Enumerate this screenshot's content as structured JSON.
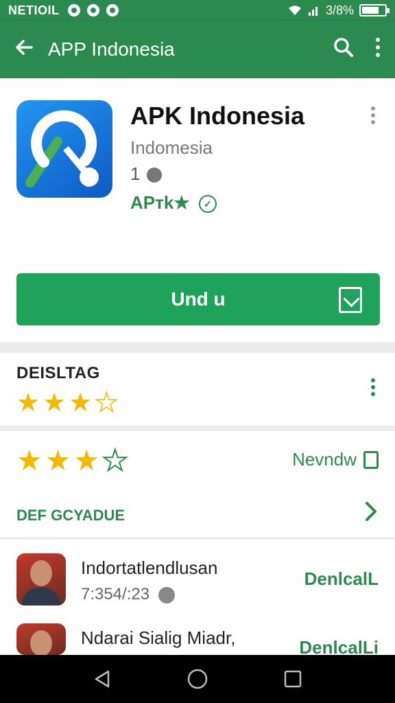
{
  "status_bar": {
    "carrier": "NETIOIL",
    "battery": "3/8%"
  },
  "app_bar": {
    "title": "APP Indonesia"
  },
  "app": {
    "name": "APK Indonesia",
    "developer": "Indomesia",
    "meta": "1",
    "tag": "APтk★",
    "install_label": "Und u",
    "icon_colors": [
      "#2196f3",
      "#0d5bc4"
    ]
  },
  "rating": {
    "title": "DEISLTAG",
    "stars": [
      "full",
      "full",
      "full",
      "empty"
    ]
  },
  "review": {
    "stars": [
      "full",
      "full",
      "full",
      "outline"
    ],
    "write_label": "Nevndw",
    "more_label": "DEF GCYADUE"
  },
  "list": [
    {
      "title": "Indortatlendlusan",
      "subtitle": "7:354/:23",
      "action": "DenlcalL"
    },
    {
      "title": "Ndarai Sialig Miadr,",
      "subtitle": "",
      "action": "DenlcalLi"
    }
  ],
  "colors": {
    "primary": "#2b8a4d",
    "install": "#1fa25a",
    "star": "#f5b800"
  }
}
